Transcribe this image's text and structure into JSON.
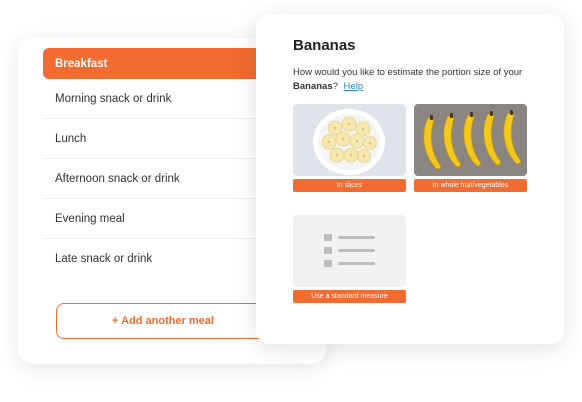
{
  "meals": {
    "items": [
      {
        "label": "Breakfast"
      },
      {
        "label": "Morning snack or drink"
      },
      {
        "label": "Lunch"
      },
      {
        "label": "Afternoon snack or drink"
      },
      {
        "label": "Evening meal"
      },
      {
        "label": "Late snack or drink"
      }
    ],
    "add_label": "+ Add another meal"
  },
  "portion": {
    "title": "Bananas",
    "question_prefix": "How would you like to estimate the portion size of your ",
    "food_name": "Bananas",
    "question_suffix": "?",
    "help_label": "Help",
    "options": [
      {
        "label": "In slices",
        "icon": "banana-slices-photo"
      },
      {
        "label": "In whole fruit/vegetables",
        "icon": "whole-bananas-photo"
      },
      {
        "label": "Use a standard measure",
        "icon": "list-icon"
      }
    ]
  },
  "colors": {
    "accent": "#f26b30",
    "link": "#2a86d4"
  }
}
